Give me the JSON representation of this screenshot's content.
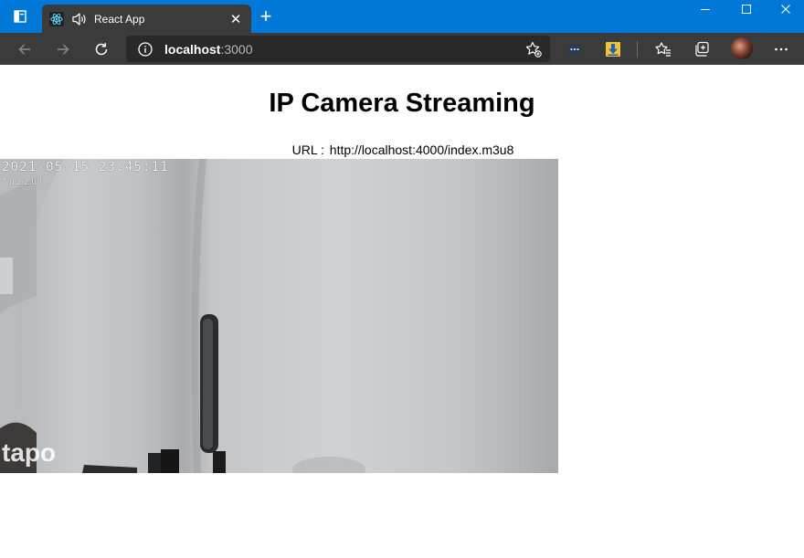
{
  "browser": {
    "tab": {
      "title": "React App"
    },
    "address": {
      "host": "localhost",
      "port": ":3000"
    }
  },
  "page": {
    "title": "IP Camera Streaming",
    "url_label": "URL :",
    "url_value": "http://localhost:4000/index.m3u8"
  },
  "video": {
    "timestamp": "2021-05-15 23:45:11",
    "camera_name": "fazzul",
    "brand": "tapo"
  },
  "colors": {
    "titlebar": "#0078d7",
    "toolbar": "#3b3b3b",
    "addressbar": "#292929"
  },
  "icons": [
    "tab-actions-icon",
    "react-favicon-icon",
    "speaker-icon",
    "close-icon",
    "plus-icon",
    "minimize-icon",
    "maximize-icon",
    "back-icon",
    "forward-icon",
    "refresh-icon",
    "info-icon",
    "add-favorite-icon",
    "extension-icon",
    "download-extension-icon",
    "favorites-icon",
    "collections-icon",
    "more-icon"
  ]
}
